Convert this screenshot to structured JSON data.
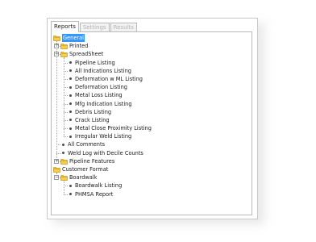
{
  "tabs": [
    {
      "label": "Reports",
      "active": true
    },
    {
      "label": "Settings",
      "active": false
    },
    {
      "label": "Results",
      "active": false
    }
  ],
  "tree": [
    {
      "label": "General",
      "type": "folder",
      "level": 0,
      "expander": "none",
      "selected": true
    },
    {
      "label": "Printed",
      "type": "folder",
      "level": 1,
      "expander": "+"
    },
    {
      "label": "SpreadSheet",
      "type": "folder",
      "level": 1,
      "expander": "-"
    },
    {
      "label": "Pipeline Listing",
      "type": "leaf",
      "level": 2
    },
    {
      "label": "All Indications Listing",
      "type": "leaf",
      "level": 2
    },
    {
      "label": "Deformation w ML Listing",
      "type": "leaf",
      "level": 2
    },
    {
      "label": "Deformation Listing",
      "type": "leaf",
      "level": 2
    },
    {
      "label": "Metal Loss Listing",
      "type": "leaf",
      "level": 2
    },
    {
      "label": "Mfg Indication Listing",
      "type": "leaf",
      "level": 2
    },
    {
      "label": "Debris Listing",
      "type": "leaf",
      "level": 2
    },
    {
      "label": "Crack Listing",
      "type": "leaf",
      "level": 2
    },
    {
      "label": "Metal Close Proximity Listing",
      "type": "leaf",
      "level": 2
    },
    {
      "label": "Irregular Weld Listing",
      "type": "leaf",
      "level": 2
    },
    {
      "label": "All Comments",
      "type": "leaf",
      "level": 1
    },
    {
      "label": "Weld Log with Decile Counts",
      "type": "leaf",
      "level": 1
    },
    {
      "label": "Pipeline Features",
      "type": "folder",
      "level": 1,
      "expander": "+"
    },
    {
      "label": "Customer Format",
      "type": "folder",
      "level": 0,
      "expander": "none"
    },
    {
      "label": "Boardwalk",
      "type": "folder",
      "level": 1,
      "expander": "-"
    },
    {
      "label": "Boardwalk Listing",
      "type": "leaf",
      "level": 2
    },
    {
      "label": "PHMSA Report",
      "type": "leaf",
      "level": 2
    }
  ],
  "colors": {
    "folder": "#e8b923",
    "selection": "#3399ff",
    "leaf_dot": "#4a4a4a"
  },
  "icons": {
    "folder": "folder-icon",
    "leaf": "bullet-icon",
    "expand": "plus-box-icon",
    "collapse": "minus-box-icon"
  }
}
